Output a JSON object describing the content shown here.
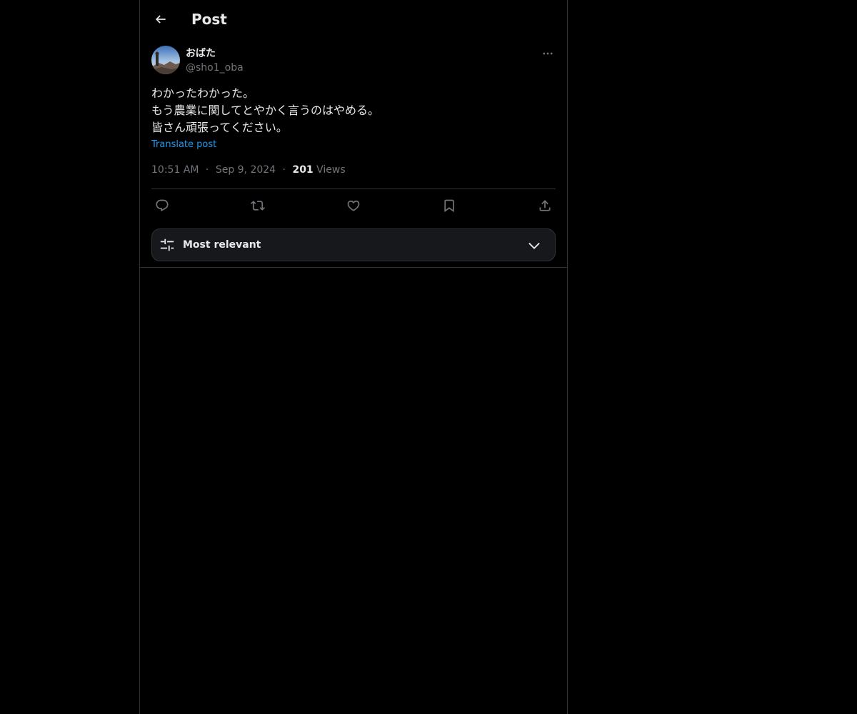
{
  "header": {
    "title": "Post",
    "back_icon": "arrow-left-icon"
  },
  "post": {
    "author_name": "おばた",
    "author_handle": "@sho1_oba",
    "avatar_icon": "avatar-image",
    "more_icon": "more-horizontal-icon",
    "text_lines": [
      "わかったわかった。",
      "もう農業に関してとやかく言うのはやめる。",
      "皆さん頑張ってください。"
    ],
    "translate_label": "Translate post",
    "time": "10:51 AM",
    "date": "Sep 9, 2024",
    "views_count": "201",
    "views_label": "Views",
    "separator": "·"
  },
  "actions": [
    {
      "name": "reply",
      "icon": "reply-icon"
    },
    {
      "name": "repost",
      "icon": "repost-icon"
    },
    {
      "name": "like",
      "icon": "heart-icon"
    },
    {
      "name": "bookmark",
      "icon": "bookmark-icon"
    },
    {
      "name": "share",
      "icon": "share-icon"
    }
  ],
  "sort": {
    "label": "Most relevant",
    "icon": "sliders-icon",
    "chevron_icon": "chevron-down-icon"
  },
  "colors": {
    "background": "#000000",
    "text": "#e7e9ea",
    "muted": "#71767b",
    "accent": "#1d9bf0",
    "border": "#2f3336"
  }
}
